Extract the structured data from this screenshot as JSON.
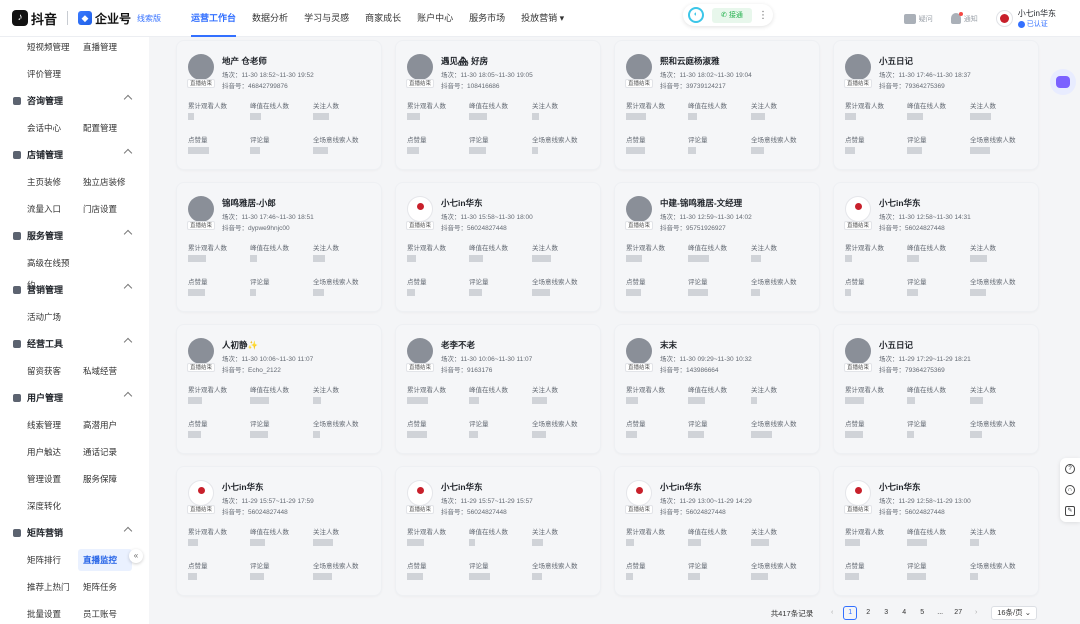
{
  "header": {
    "brand": "抖音",
    "brand_ent": "企业号",
    "brand_tag": "线索版",
    "nav": [
      {
        "label": "运营工作台",
        "active": true
      },
      {
        "label": "数据分析"
      },
      {
        "label": "学习与灵感"
      },
      {
        "label": "商家成长"
      },
      {
        "label": "账户中心"
      },
      {
        "label": "服务市场"
      },
      {
        "label": "投放营销 ▾"
      }
    ],
    "call_label": "接通",
    "tools": [
      {
        "label": "疑问"
      },
      {
        "label": "通知"
      }
    ],
    "user_name": "小七in华东",
    "user_verified": "已认证"
  },
  "sidebar": {
    "groups": [
      {
        "title": "",
        "items": [
          "短视频管理",
          "直播管理",
          "评价管理"
        ]
      },
      {
        "title": "咨询管理",
        "items": [
          "会话中心",
          "配置管理"
        ]
      },
      {
        "title": "店铺管理",
        "items": [
          "主页装修",
          "独立店装修",
          "流量入口",
          "门店设置"
        ]
      },
      {
        "title": "服务管理",
        "items": [
          "高级在线预约"
        ]
      },
      {
        "title": "营销管理",
        "items": [
          "活动广场"
        ]
      },
      {
        "title": "经营工具",
        "items": [
          "留资获客",
          "私域经营"
        ]
      },
      {
        "title": "用户管理",
        "items": [
          "线索管理",
          "高潜用户",
          "用户触达",
          "通话记录",
          "管理设置",
          "服务保障",
          "深度转化"
        ]
      },
      {
        "title": "矩阵营销",
        "items": [
          "矩阵排行",
          "直播监控",
          "推荐上热门",
          "矩阵任务",
          "批量设置",
          "员工账号"
        ]
      }
    ],
    "active_item": "直播监控"
  },
  "labels": {
    "badge": "直播结束",
    "viewers": "累计观看人数",
    "peak": "峰值在线人数",
    "follow": "关注人数",
    "likes": "点赞量",
    "comments": "评论量",
    "leads": "全场意线索人数"
  },
  "cards": [
    {
      "name": "地产 仓老师",
      "session": "场次：11-30 18:52~11-30 19:52",
      "account": "抖音号：46842799876",
      "avatar": "photo"
    },
    {
      "name": "遇见🏘 好房",
      "session": "场次：11-30 18:05~11-30 19:05",
      "account": "抖音号：108416686",
      "avatar": "photo"
    },
    {
      "name": "熙和云庭杨淑雅",
      "session": "场次：11-30 18:02~11-30 19:04",
      "account": "抖音号：39739124217",
      "avatar": "photo"
    },
    {
      "name": "小五日记",
      "session": "场次：11-30 17:46~11-30 18:37",
      "account": "抖音号：79364275369",
      "avatar": "photo"
    },
    {
      "name": "锦鸣雅居-小郎",
      "session": "场次：11-30 17:46~11-30 18:51",
      "account": "抖音号：dypwe9hnjc00",
      "avatar": "photo"
    },
    {
      "name": "小七in华东",
      "session": "场次：11-30 15:58~11-30 18:00",
      "account": "抖音号：56024827448",
      "avatar": "logo"
    },
    {
      "name": "中建-锦鸣雅居-文经理",
      "session": "场次：11-30 12:59~11-30 14:02",
      "account": "抖音号：95751926927",
      "avatar": "photo"
    },
    {
      "name": "小七in华东",
      "session": "场次：11-30 12:58~11-30 14:31",
      "account": "抖音号：56024827448",
      "avatar": "logo"
    },
    {
      "name": "人初静✨",
      "session": "场次：11-30 10:06~11-30 11:07",
      "account": "抖音号：Echo_2122",
      "avatar": "photo"
    },
    {
      "name": "老李不老",
      "session": "场次：11-30 10:06~11-30 11:07",
      "account": "抖音号：9163176",
      "avatar": "photo"
    },
    {
      "name": "末末",
      "session": "场次：11-30 09:29~11-30 10:32",
      "account": "抖音号：143986664",
      "avatar": "photo"
    },
    {
      "name": "小五日记",
      "session": "场次：11-29 17:29~11-29 18:21",
      "account": "抖音号：79364275369",
      "avatar": "photo"
    },
    {
      "name": "小七in华东",
      "session": "场次：11-29 15:57~11-29 17:59",
      "account": "抖音号：56024827448",
      "avatar": "logo"
    },
    {
      "name": "小七in华东",
      "session": "场次：11-29 15:57~11-29 15:57",
      "account": "抖音号：56024827448",
      "avatar": "logo"
    },
    {
      "name": "小七in华东",
      "session": "场次：11-29 13:00~11-29 14:29",
      "account": "抖音号：56024827448",
      "avatar": "logo"
    },
    {
      "name": "小七in华东",
      "session": "场次：11-29 12:58~11-29 13:00",
      "account": "抖音号：56024827448",
      "avatar": "logo"
    }
  ],
  "pagination": {
    "total": "共417条记录",
    "pages": [
      "1",
      "2",
      "3",
      "4",
      "5",
      "...",
      "27"
    ],
    "current": "1",
    "prev": "‹",
    "next": "›",
    "page_size": "16条/页 ⌄"
  }
}
